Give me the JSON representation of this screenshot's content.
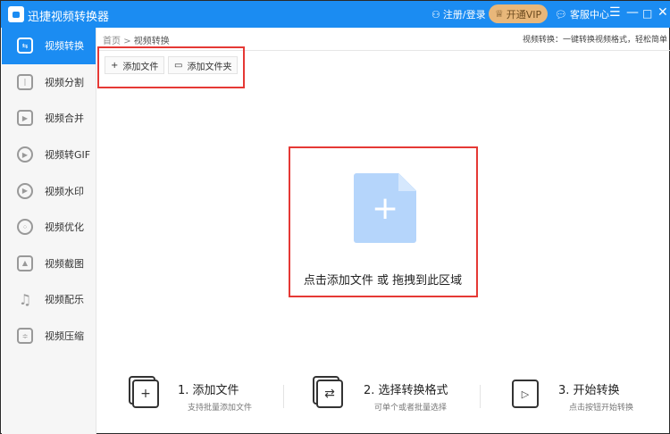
{
  "app": {
    "title": "迅捷视频转换器",
    "login": "注册/登录",
    "vip": "开通VIP",
    "service": "客服中心"
  },
  "sidebar": {
    "items": [
      {
        "label": "视频转换",
        "icon": "convert-icon"
      },
      {
        "label": "视频分割",
        "icon": "split-icon"
      },
      {
        "label": "视频合并",
        "icon": "merge-icon"
      },
      {
        "label": "视频转GIF",
        "icon": "gif-icon"
      },
      {
        "label": "视频水印",
        "icon": "watermark-icon"
      },
      {
        "label": "视频优化",
        "icon": "optimize-icon"
      },
      {
        "label": "视频截图",
        "icon": "screenshot-icon"
      },
      {
        "label": "视频配乐",
        "icon": "music-icon"
      },
      {
        "label": "视频压缩",
        "icon": "compress-icon"
      }
    ]
  },
  "breadcrumb": {
    "home": "首页",
    "sep": ">",
    "current": "视频转换"
  },
  "description": "视频转换：一键转换视频格式，轻松简单",
  "toolbar": {
    "add_file": "添加文件",
    "add_folder": "添加文件夹"
  },
  "dropzone": {
    "text": "点击添加文件 或 拖拽到此区域"
  },
  "steps": [
    {
      "title": "1. 添加文件",
      "sub": "支持批量添加文件"
    },
    {
      "title": "2. 选择转换格式",
      "sub": "可单个或者批量选择"
    },
    {
      "title": "3. 开始转换",
      "sub": "点击按钮开始转换"
    }
  ]
}
